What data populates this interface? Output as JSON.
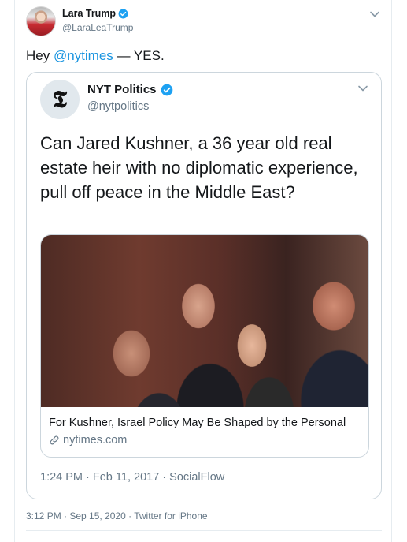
{
  "tweet": {
    "author_name": "Lara Trump",
    "author_handle": "@LaraLeaTrump",
    "text_prefix": "Hey ",
    "mention": "@nytimes",
    "text_suffix": " — YES.",
    "meta": "3:12 PM · Sep 15, 2020 · Twitter for iPhone"
  },
  "quoted": {
    "author_name": "NYT Politics",
    "author_handle": "@nytpolitics",
    "avatar_glyph": "𝕿",
    "text": "Can Jared Kushner, a 36 year old real estate heir with no diplomatic experience, pull off peace in the Middle East?",
    "link_title": "For Kushner, Israel Policy May Be Shaped by the Personal",
    "link_domain": "nytimes.com",
    "meta": "1:24 PM · Feb 11, 2017 · SocialFlow"
  },
  "icons": {
    "verified": "verified-badge-icon",
    "chevron": "chevron-down-icon",
    "link": "link-icon"
  },
  "colors": {
    "accent": "#1b95e0",
    "secondary_text": "#657786",
    "border": "#ccd6dd"
  }
}
